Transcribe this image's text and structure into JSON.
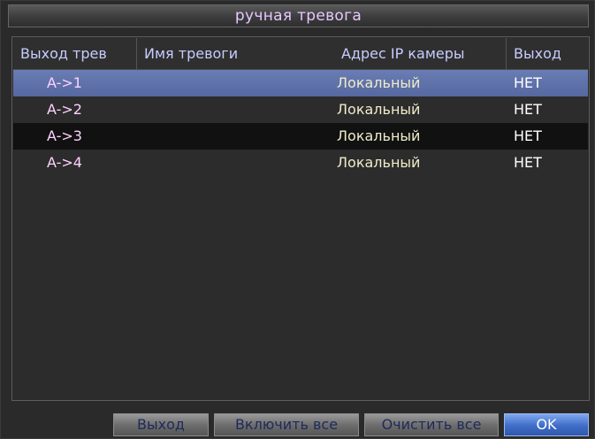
{
  "window": {
    "title": "ручная тревога"
  },
  "table": {
    "columns": [
      "Выход трев",
      "Имя тревоги",
      "Адрес IP камеры",
      "Выход"
    ],
    "rows": [
      {
        "output": "A->1",
        "name": "",
        "address": "Локальный",
        "state": "НЕТ"
      },
      {
        "output": "A->2",
        "name": "",
        "address": "Локальный",
        "state": "НЕТ"
      },
      {
        "output": "A->3",
        "name": "",
        "address": "Локальный",
        "state": "НЕТ"
      },
      {
        "output": "A->4",
        "name": "",
        "address": "Локальный",
        "state": "НЕТ"
      }
    ],
    "selected_row": 0
  },
  "buttons": {
    "exit": "Выход",
    "enable_all": "Включить все",
    "clear_all": "Очистить все",
    "ok": "OK"
  }
}
